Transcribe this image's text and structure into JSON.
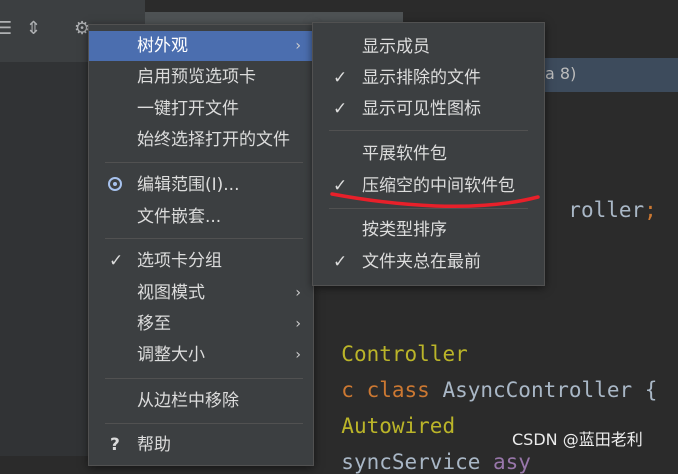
{
  "toolbar": {
    "icons": [
      "align-icon",
      "collapse-icon",
      "gear-icon"
    ]
  },
  "editor": {
    "banner_text": "a 8)",
    "code_lines": [
      {
        "parts": [
          {
            "t": "roller",
            "c": "plain"
          },
          {
            "t": ";",
            "c": "kw"
          }
        ]
      },
      {
        "parts": [
          {
            "t": "Controller",
            "c": "ann"
          }
        ]
      },
      {
        "parts": [
          {
            "t": "c ",
            "c": "kw"
          },
          {
            "t": "class ",
            "c": "kw"
          },
          {
            "t": "AsyncController {",
            "c": "plain"
          }
        ]
      },
      {
        "parts": [
          {
            "t": "Autowired",
            "c": "ann"
          }
        ]
      },
      {
        "parts": [
          {
            "t": "syncService ",
            "c": "plain"
          },
          {
            "t": "asy",
            "c": "field"
          }
        ]
      }
    ]
  },
  "main_menu": {
    "items": [
      {
        "label": "树外观",
        "highlighted": true,
        "submenu": true
      },
      {
        "label": "启用预览选项卡"
      },
      {
        "label": "一键打开文件"
      },
      {
        "label": "始终选择打开的文件"
      },
      {
        "label": "编辑范围(I)...",
        "radio": true
      },
      {
        "label": "文件嵌套..."
      },
      {
        "label": "选项卡分组",
        "checked": true
      },
      {
        "label": "视图模式",
        "submenu": true
      },
      {
        "label": "移至",
        "submenu": true
      },
      {
        "label": "调整大小",
        "submenu": true
      },
      {
        "label": "从边栏中移除"
      },
      {
        "label": "帮助",
        "help": true
      }
    ]
  },
  "sub_menu": {
    "items": [
      {
        "label": "显示成员"
      },
      {
        "label": "显示排除的文件",
        "checked": true
      },
      {
        "label": "显示可见性图标",
        "checked": true
      },
      {
        "label": "平展软件包"
      },
      {
        "label": "压缩空的中间软件包",
        "checked": true
      },
      {
        "label": "按类型排序"
      },
      {
        "label": "文件夹总在最前",
        "checked": true
      }
    ]
  },
  "glyphs": {
    "check": "✓",
    "arrow": "›",
    "help": "?"
  },
  "annotation_color": "#e8202a",
  "watermark": "CSDN @蓝田老利"
}
